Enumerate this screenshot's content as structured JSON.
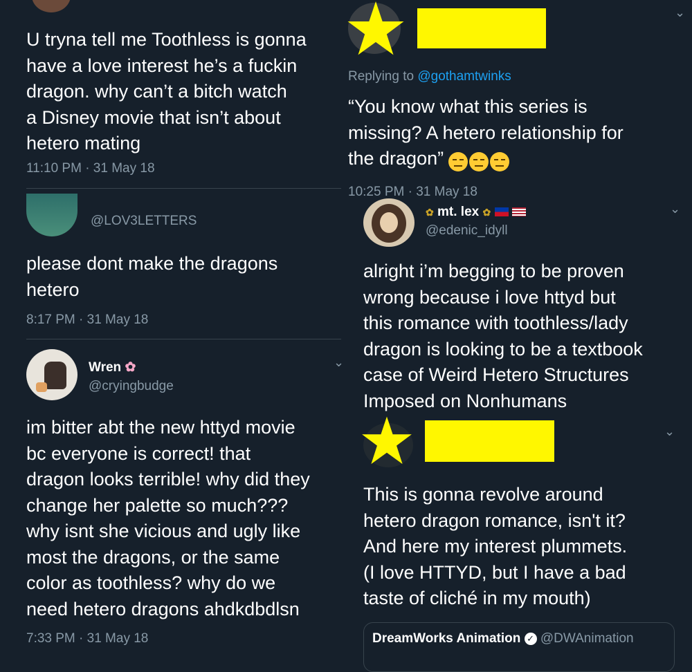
{
  "left": {
    "tweet1": {
      "text": "U tryna tell me Toothless is gonna\nhave a love interest he’s a fuckin\ndragon. why can’t a bitch watch\na Disney movie that isn’t about\nhetero mating",
      "timestamp": "11:10 PM · 31 May 18"
    },
    "tweet2": {
      "handle": "@LOV3LETTERS",
      "text": "please dont make the dragons\nhetero",
      "timestamp": "8:17 PM · 31 May 18"
    },
    "tweet3": {
      "name": "Wren",
      "name_emoji": "✿",
      "handle": "@cryingbudge",
      "text": "im bitter abt the new httyd movie\nbc everyone is correct! that\ndragon looks terrible! why did they\nchange her palette so much???\nwhy isnt she vicious and ugly like\nmost the dragons, or the same\ncolor as toothless? why do we\nneed hetero dragons ahdkdbdlsn",
      "timestamp": "7:33 PM · 31 May 18"
    }
  },
  "right": {
    "tweet1": {
      "replying_prefix": "Replying to ",
      "replying_handle": "@gothamtwinks",
      "text": "“You know what this series is\nmissing? A hetero relationship for\nthe dragon”",
      "timestamp": "10:25 PM · 31 May 18"
    },
    "tweet2": {
      "name": "mt. lex",
      "handle": "@edenic_idyll",
      "text": "alright i’m begging to be proven\nwrong because i love httyd but\nthis romance with toothless/lady\ndragon is looking to be a textbook\ncase of Weird Hetero Structures\nImposed on Nonhumans"
    },
    "tweet3": {
      "text": "This is gonna revolve around\nhetero dragon romance, isn't it?\nAnd here my interest plummets.\n(I love HTTYD, but I have a bad\ntaste of cliché in my mouth)",
      "quote_name": "DreamWorks Animation",
      "quote_handle": "@DWAnimation"
    }
  },
  "colors": {
    "background": "#16202b",
    "text": "#ffffff",
    "muted": "#8899a6",
    "link": "#1da1f2",
    "censor": "#fff700"
  }
}
